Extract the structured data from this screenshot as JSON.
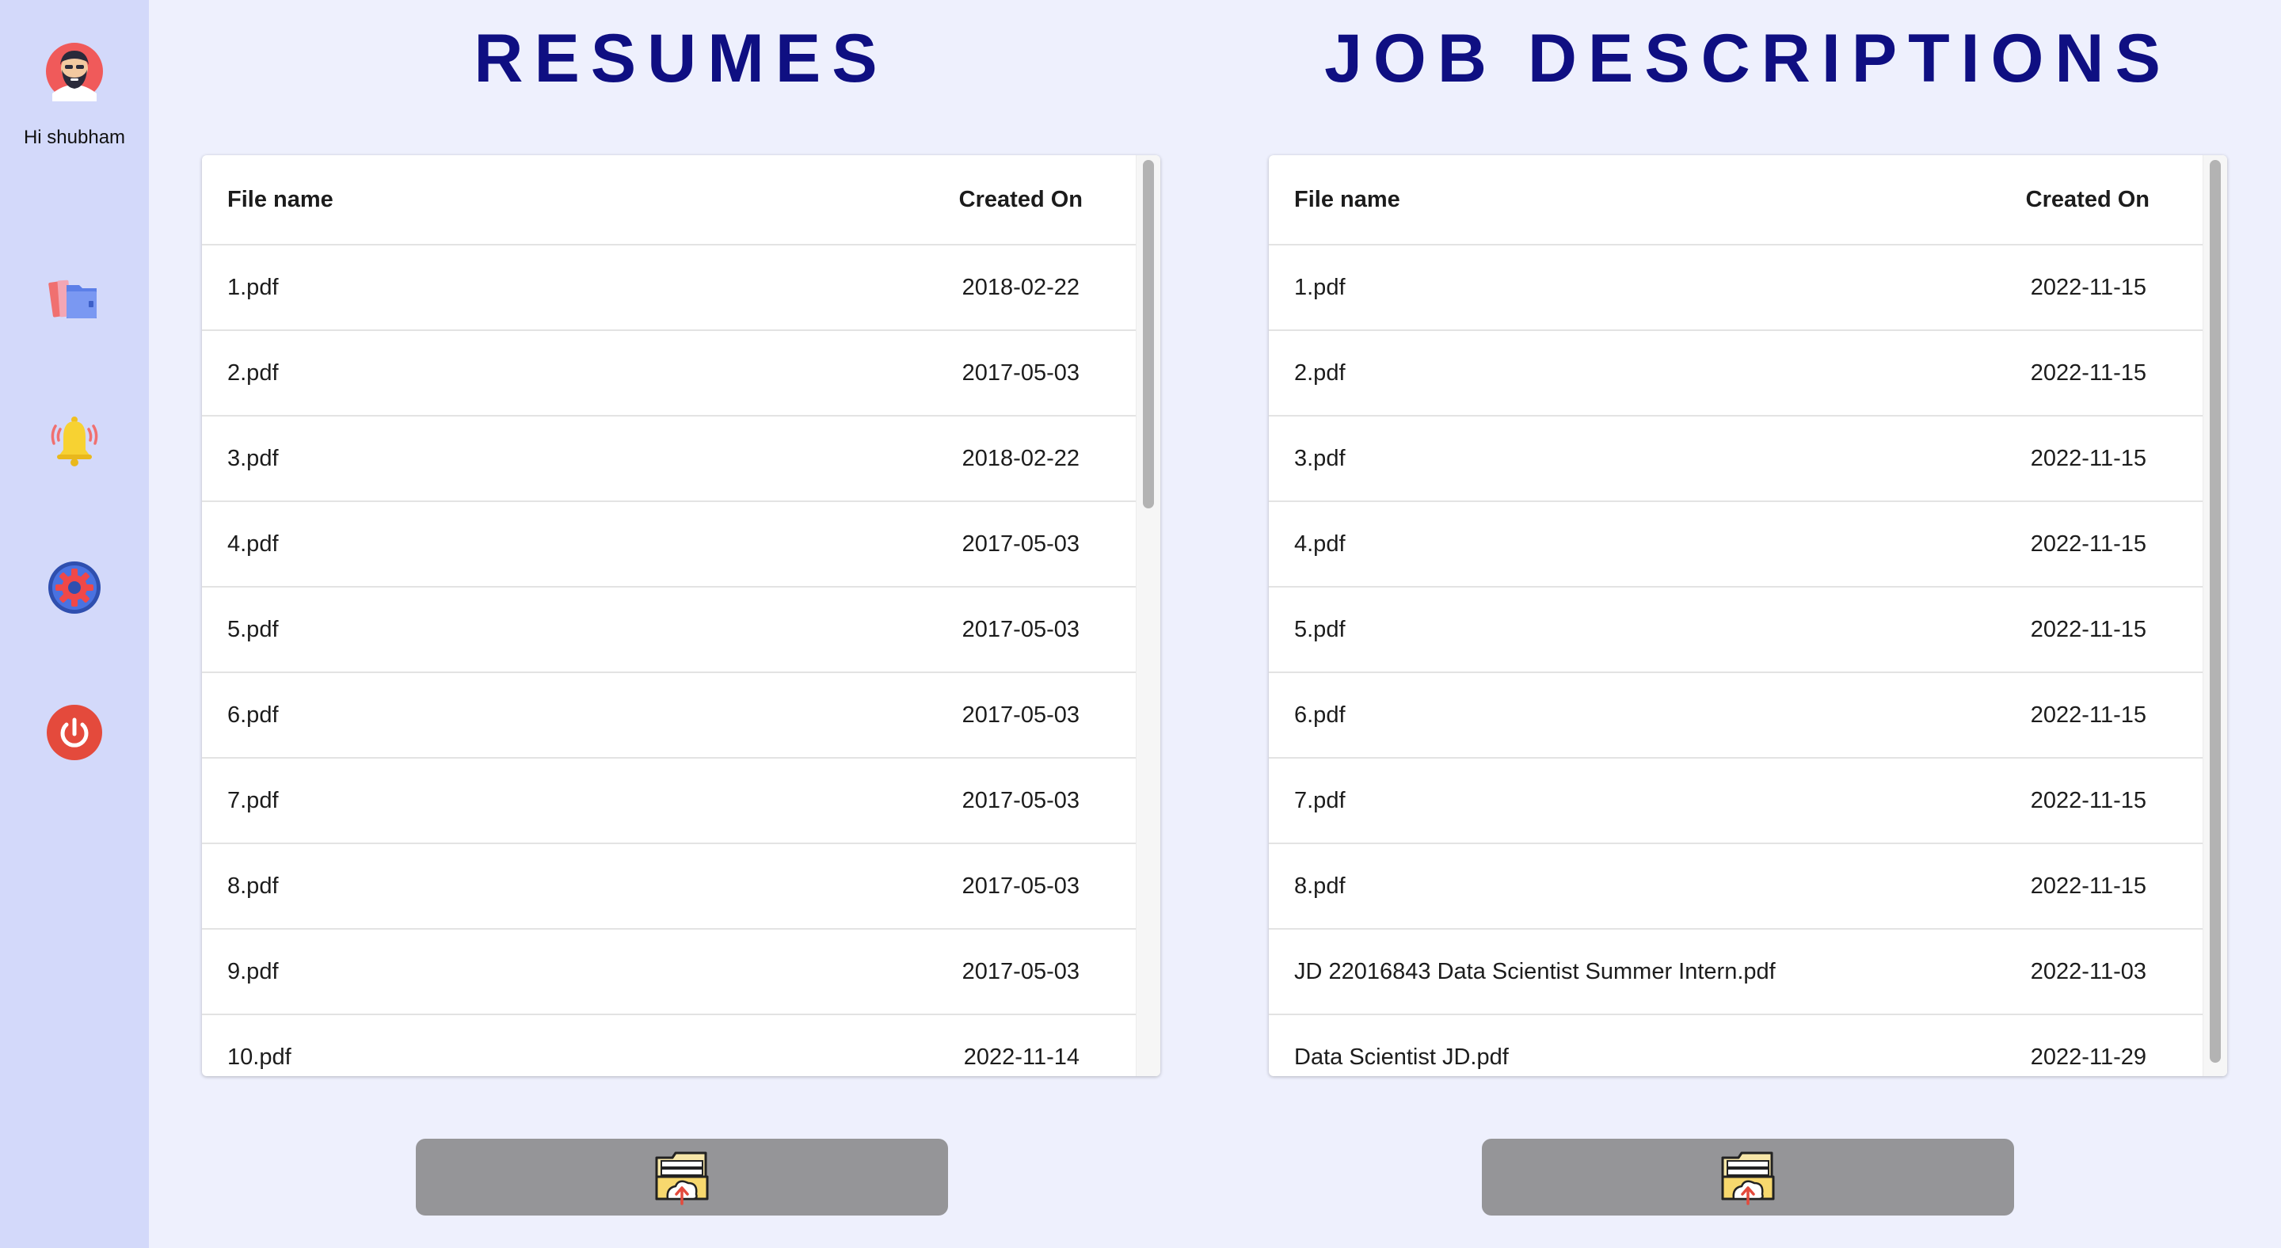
{
  "sidebar": {
    "greeting": "Hi shubham",
    "icons": [
      "avatar-icon",
      "files-icon",
      "bell-icon",
      "settings-icon",
      "power-icon"
    ]
  },
  "resumes": {
    "title": "RESUMES",
    "columns": {
      "name": "File name",
      "created": "Created On"
    },
    "rows": [
      {
        "name": "1.pdf",
        "created": "2018-02-22"
      },
      {
        "name": "2.pdf",
        "created": "2017-05-03"
      },
      {
        "name": "3.pdf",
        "created": "2018-02-22"
      },
      {
        "name": "4.pdf",
        "created": "2017-05-03"
      },
      {
        "name": "5.pdf",
        "created": "2017-05-03"
      },
      {
        "name": "6.pdf",
        "created": "2017-05-03"
      },
      {
        "name": "7.pdf",
        "created": "2017-05-03"
      },
      {
        "name": "8.pdf",
        "created": "2017-05-03"
      },
      {
        "name": "9.pdf",
        "created": "2017-05-03"
      },
      {
        "name": "10.pdf",
        "created": "2022-11-14"
      }
    ],
    "upload_icon": "folder-upload-icon"
  },
  "job_descriptions": {
    "title": "JOB DESCRIPTIONS",
    "columns": {
      "name": "File name",
      "created": "Created On"
    },
    "rows": [
      {
        "name": "1.pdf",
        "created": "2022-11-15"
      },
      {
        "name": "2.pdf",
        "created": "2022-11-15"
      },
      {
        "name": "3.pdf",
        "created": "2022-11-15"
      },
      {
        "name": "4.pdf",
        "created": "2022-11-15"
      },
      {
        "name": "5.pdf",
        "created": "2022-11-15"
      },
      {
        "name": "6.pdf",
        "created": "2022-11-15"
      },
      {
        "name": "7.pdf",
        "created": "2022-11-15"
      },
      {
        "name": "8.pdf",
        "created": "2022-11-15"
      },
      {
        "name": "JD 22016843 Data Scientist Summer Intern.pdf",
        "created": "2022-11-03"
      },
      {
        "name": "Data Scientist JD.pdf",
        "created": "2022-11-29"
      }
    ],
    "upload_icon": "folder-upload-icon"
  },
  "colors": {
    "page_bg": "#eef0fd",
    "sidebar_bg": "#d3d9fa",
    "title": "#0f0f82",
    "button_bg": "#959598"
  }
}
